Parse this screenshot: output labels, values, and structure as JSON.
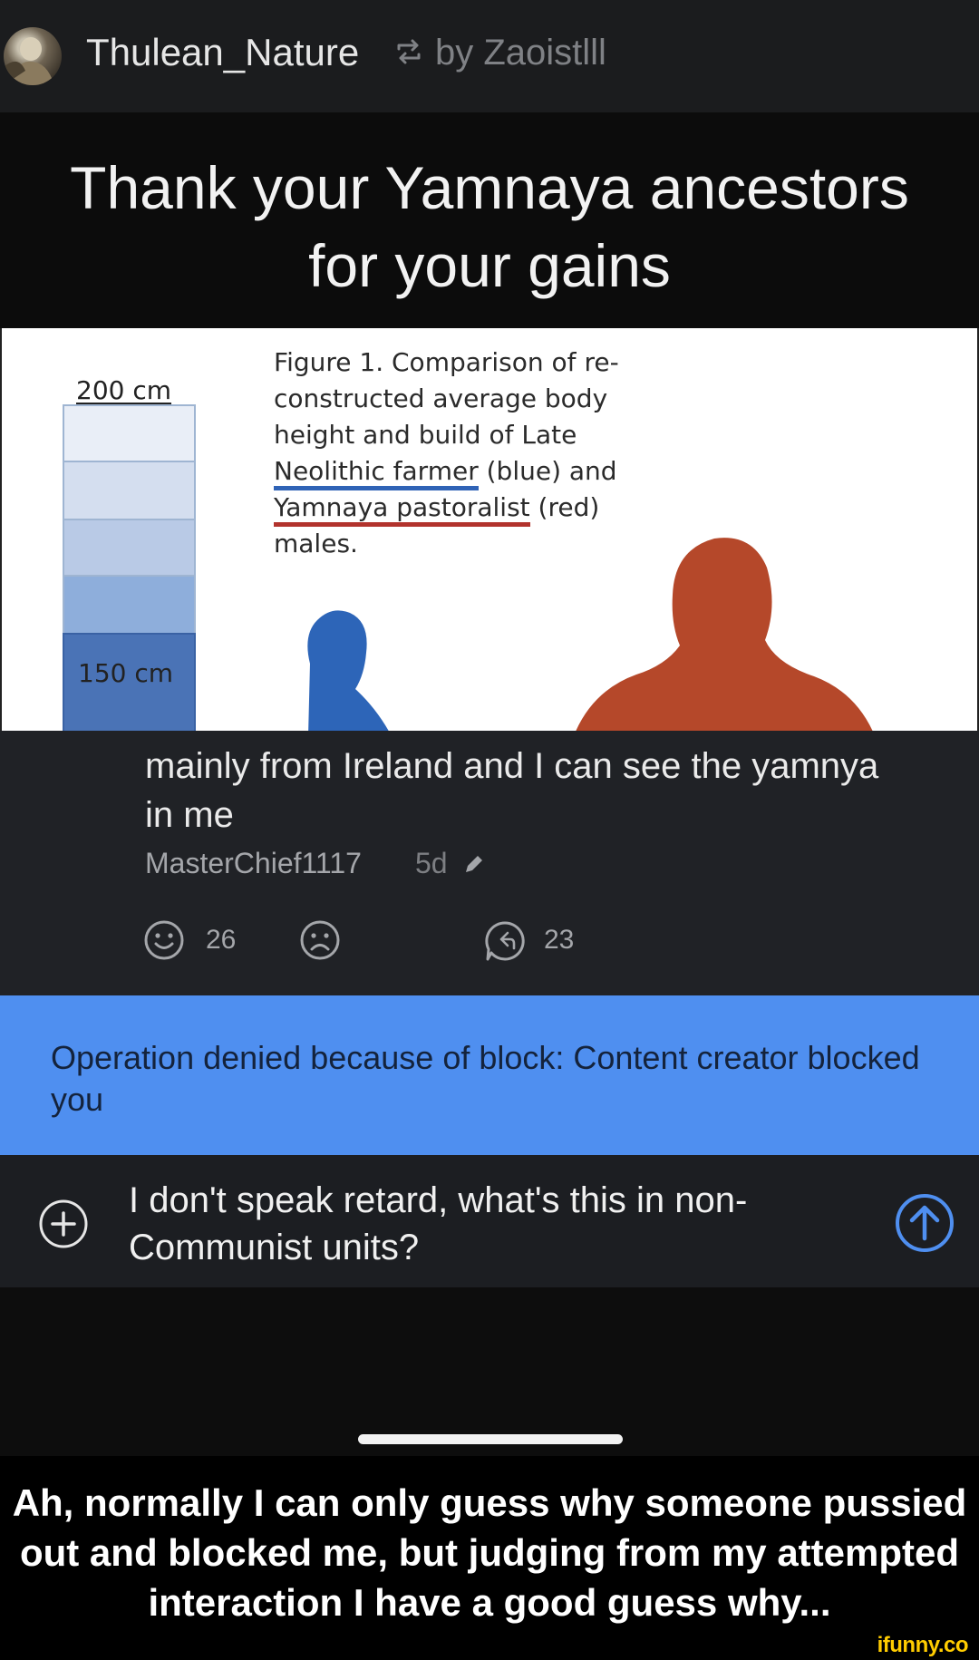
{
  "post": {
    "username": "Thulean_Nature",
    "repost_by": "by Zaoistlll",
    "headline_line1": "Thank your Yamnaya ancestors",
    "headline_line2": "for your gains"
  },
  "figure": {
    "scale_top": "200 cm",
    "scale_bottom": "150 cm",
    "caption_lines": [
      "Figure 1. Comparison of re-",
      "constructed average body",
      "height and build of Late"
    ],
    "neolithic_term": "Neolithic farmer",
    "neolithic_rest": " (blue) and",
    "yamnaya_term": "Yamnaya pastoralist",
    "yamnaya_rest": " (red)",
    "last_line": "males.",
    "colors": {
      "blue": "#2f63b6",
      "red": "#b2332d"
    }
  },
  "comment": {
    "text": "mainly from Ireland and I can see the yamnya in me",
    "author": "MasterChief1117",
    "age": "5d",
    "smile_count": "26",
    "reply_count": "23"
  },
  "banner": {
    "message": "Operation denied because of block: Content creator blocked you",
    "color": "#4f8ff0"
  },
  "compose": {
    "text": "I don't speak retard, what's this in non-Communist units?"
  },
  "caption": {
    "text": "Ah, normally I can only guess why someone pussied out and blocked me, but judging from my attempted interaction I have a good guess why..."
  },
  "watermark": "ifunny.co",
  "icons": [
    "avatar",
    "repost-icon",
    "edit-icon",
    "smile-icon",
    "frown-icon",
    "reply-icon",
    "add-icon",
    "send-icon"
  ]
}
